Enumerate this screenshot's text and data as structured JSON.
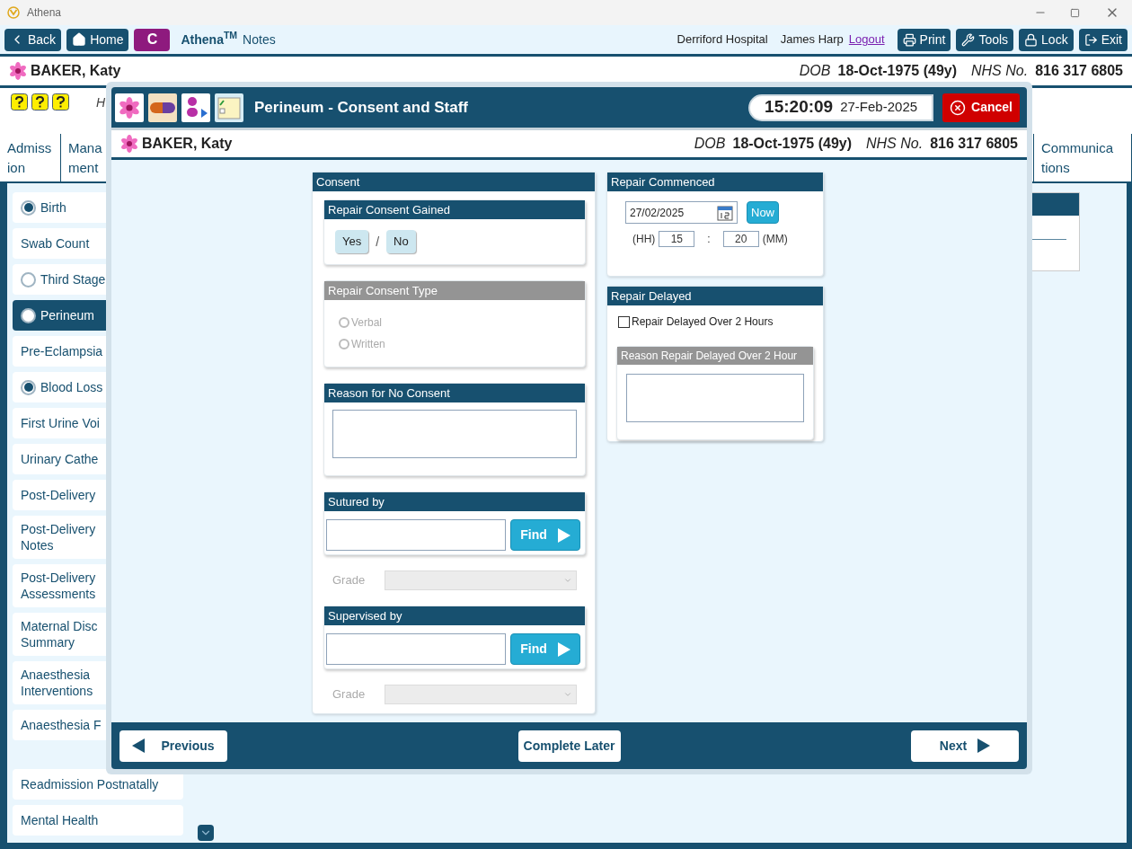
{
  "window": {
    "title": "Athena"
  },
  "toolbar": {
    "left_buttons": [
      {
        "kind": "back",
        "label": "Back"
      },
      {
        "kind": "home",
        "label": "Home"
      },
      {
        "kind": "letter",
        "label": "C"
      }
    ],
    "app_name": "Athena$^{TM}$",
    "app_suffix": "Notes",
    "hospital": "Derriford Hospital",
    "user": "James Harp",
    "logout": "Logout",
    "right_buttons": [
      {
        "kind": "print",
        "label": "Print"
      },
      {
        "kind": "tools",
        "label": "Tools"
      },
      {
        "kind": "lock",
        "label": "Lock"
      },
      {
        "kind": "exit",
        "label": "Exit"
      }
    ]
  },
  "patient": {
    "name": "BAKER, Katy",
    "dob_label": "DOB",
    "dob": "18-Oct-1975 (49y)",
    "nhs_label": "NHS No.",
    "nhs": "816 317 6805"
  },
  "alert_text": "H",
  "tabs": [
    {
      "lines": [
        "Admiss",
        "ion"
      ],
      "selected": false
    },
    {
      "lines": [
        "Mana",
        "ment"
      ],
      "selected": false
    },
    {
      "lines": [
        "Communica",
        "tions"
      ],
      "selected": false
    }
  ],
  "sidebar": {
    "groups": [
      [
        {
          "lines": [
            "Birth"
          ],
          "kind": "radio",
          "checked": true,
          "selected": false
        },
        {
          "lines": [
            "Swab Count"
          ],
          "kind": "plain",
          "selected": false
        },
        {
          "lines": [
            "Third Stage"
          ],
          "kind": "radio",
          "checked": false,
          "selected": false
        },
        {
          "lines": [
            "Perineum"
          ],
          "kind": "radio",
          "checked": false,
          "selected": true
        },
        {
          "lines": [
            "Pre-Eclampsia"
          ],
          "kind": "plain",
          "selected": false
        },
        {
          "lines": [
            "Blood Loss"
          ],
          "kind": "radio",
          "checked": true,
          "selected": false
        },
        {
          "lines": [
            "First Urine Voi"
          ],
          "kind": "plain",
          "selected": false
        },
        {
          "lines": [
            "Urinary Cathe"
          ],
          "kind": "plain",
          "selected": false
        },
        {
          "lines": [
            "Post-Delivery"
          ],
          "kind": "plain",
          "selected": false
        },
        {
          "lines": [
            "Post-Delivery",
            "Notes"
          ],
          "kind": "plain",
          "selected": false
        },
        {
          "lines": [
            "Post-Delivery",
            "Assessments"
          ],
          "kind": "plain",
          "selected": false
        },
        {
          "lines": [
            "Maternal Disc",
            "Summary"
          ],
          "kind": "plain",
          "selected": false
        },
        {
          "lines": [
            "Anaesthesia",
            "Interventions"
          ],
          "kind": "plain",
          "selected": false
        },
        {
          "lines": [
            "Anaesthesia F"
          ],
          "kind": "plain",
          "selected": false
        }
      ],
      [
        {
          "lines": [
            "Readmission Postnatally"
          ],
          "kind": "plain",
          "selected": false
        },
        {
          "lines": [
            "Mental Health"
          ],
          "kind": "plain",
          "selected": false
        }
      ]
    ]
  },
  "dialog": {
    "title": "Perineum - Consent and Staff",
    "time": "15:20:09",
    "date": "27-Feb-2025",
    "cancel": "Cancel",
    "patient": {
      "name": "BAKER, Katy",
      "dob_label": "DOB",
      "dob": "18-Oct-1975 (49y)",
      "nhs_label": "NHS No.",
      "nhs": "816 317 6805"
    },
    "consent": {
      "title": "Consent",
      "sections": [
        {
          "kind": "choice",
          "title": "Repair Consent Gained",
          "disabled": false,
          "separator": "/",
          "options": [
            {
              "label": "Yes",
              "selected": false
            },
            {
              "label": "No",
              "selected": false
            }
          ]
        },
        {
          "kind": "radio_group",
          "title": "Repair Consent Type",
          "disabled": true,
          "options": [
            {
              "label": "Verbal",
              "selected": false
            },
            {
              "label": "Written",
              "selected": false
            }
          ]
        },
        {
          "kind": "textarea",
          "title": "Reason for No Consent",
          "disabled": false
        },
        {
          "kind": "finder",
          "title": "Sutured by",
          "button": "Find"
        },
        {
          "kind": "select",
          "label": "Grade",
          "disabled": true
        },
        {
          "kind": "finder",
          "title": "Supervised by",
          "button": "Find"
        },
        {
          "kind": "select",
          "label": "Grade",
          "disabled": true
        }
      ]
    },
    "repair_commenced": {
      "title": "Repair Commenced",
      "date": "27/02/2025",
      "now": "Now",
      "hh_label": "(HH)",
      "hour": "15",
      "separator": ":",
      "minute": "20",
      "mm_label": "(MM)"
    },
    "repair_delayed": {
      "title": "Repair Delayed",
      "checkbox": {
        "label": "Repair Delayed Over 2 Hours",
        "checked": false
      },
      "reason": {
        "title": "Reason Repair Delayed Over 2 Hour",
        "disabled": true
      }
    },
    "footer": {
      "previous": "Previous",
      "complete_later": "Complete Later",
      "next": "Next"
    }
  }
}
